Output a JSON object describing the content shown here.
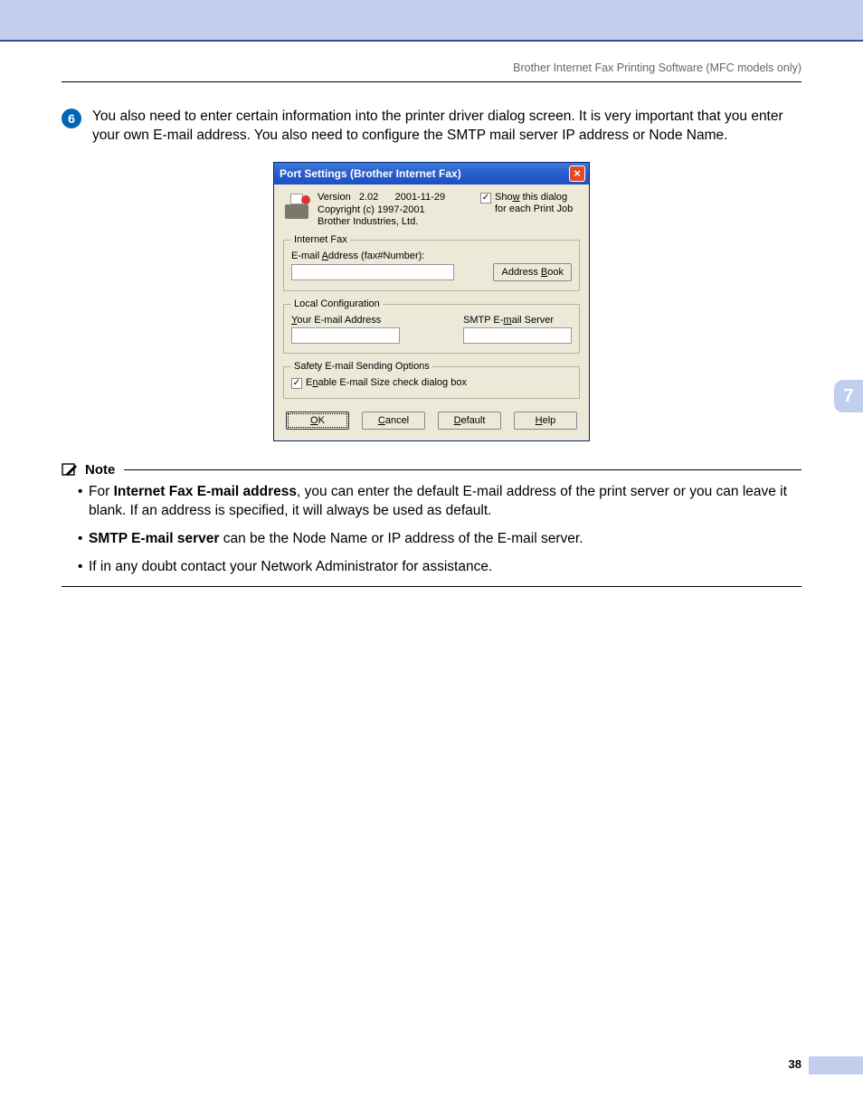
{
  "running_head": "Brother Internet Fax Printing Software (MFC models only)",
  "step": {
    "number": "6",
    "text": "You also need to enter certain information into the printer driver dialog screen. It is very important that you enter your own E-mail address. You also need to configure the SMTP mail server IP address or Node Name."
  },
  "dialog": {
    "title": "Port Settings (Brother Internet Fax)",
    "version_label": "Version",
    "version_value": "2.02",
    "date": "2001-11-29",
    "copyright": "Copyright (c) 1997-2001",
    "company": "Brother Industries, Ltd.",
    "show_dialog_checkbox": "Show this dialog for each Print Job",
    "show_dialog_checked": true,
    "group_internet_fax": "Internet Fax",
    "label_email_fax": "E-mail Address (fax#Number):",
    "btn_address_book": "Address Book",
    "group_local": "Local Configuration",
    "label_your_email": "Your E-mail Address",
    "label_smtp": "SMTP E-mail Server",
    "group_safety": "Safety E-mail Sending Options",
    "checkbox_size_check": "Enable E-mail Size check dialog box",
    "size_check_checked": true,
    "btn_ok": "OK",
    "btn_cancel": "Cancel",
    "btn_default": "Default",
    "btn_help": "Help"
  },
  "note": {
    "title": "Note",
    "items": {
      "a_bold": "Internet Fax E-mail address",
      "a_rest": ", you can enter the default E-mail address of the print server or you can leave it blank. If an address is specified, it will always be used as default.",
      "b_bold": "SMTP E-mail server",
      "b_rest": " can be the Node Name or IP address of the E-mail server.",
      "c": "If in any doubt contact your Network Administrator for assistance."
    }
  },
  "chapter_tab": "7",
  "page_number": "38"
}
